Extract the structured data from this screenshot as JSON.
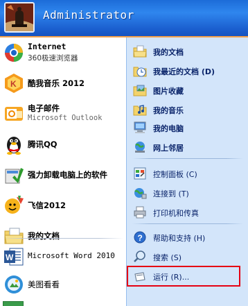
{
  "header": {
    "user_name": "Administrator"
  },
  "left": {
    "items": [
      {
        "line1": "Internet",
        "line2": "360极速浏览器",
        "icon": "browser-360-icon"
      },
      {
        "line1": "酷我音乐 2012",
        "icon": "kuwo-music-icon"
      },
      {
        "line1": "电子邮件",
        "line2": "Microsoft Outlook",
        "icon": "outlook-mail-icon"
      },
      {
        "line1": "腾讯QQ",
        "icon": "qq-penguin-icon"
      },
      {
        "line1": "强力卸载电脑上的软件",
        "icon": "uninstall-icon"
      },
      {
        "line1": "飞信2012",
        "icon": "fetion-icon"
      },
      {
        "line1": "我的文档",
        "icon": "documents-folder-icon"
      },
      {
        "line1": "Microsoft Word 2010",
        "icon": "word-icon"
      },
      {
        "line1": "美图看看",
        "icon": "meitu-viewer-icon"
      }
    ]
  },
  "right": {
    "items": [
      {
        "label": "我的文档",
        "icon": "documents-folder-icon"
      },
      {
        "label": "我最近的文档 (D)",
        "icon": "recent-documents-icon"
      },
      {
        "label": "图片收藏",
        "icon": "pictures-folder-icon"
      },
      {
        "label": "我的音乐",
        "icon": "music-folder-icon"
      },
      {
        "label": "我的电脑",
        "icon": "my-computer-icon"
      },
      {
        "label": "网上邻居",
        "icon": "network-places-icon"
      },
      {
        "label": "控制面板 (C)",
        "icon": "control-panel-icon"
      },
      {
        "label": "连接到 (T)",
        "icon": "connect-to-icon"
      },
      {
        "label": "打印机和传真",
        "icon": "printers-faxes-icon"
      },
      {
        "label": "帮助和支持 (H)",
        "icon": "help-icon"
      },
      {
        "label": "搜索 (S)",
        "icon": "search-icon"
      },
      {
        "label": "运行 (R)...",
        "icon": "run-icon"
      }
    ]
  },
  "colors": {
    "header_blue": "#2f86ee",
    "right_pane": "#d3e5fa",
    "highlight_red": "#e60012"
  }
}
